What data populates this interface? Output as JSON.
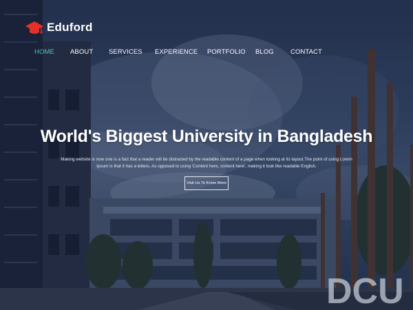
{
  "brand": {
    "name": "Eduford",
    "icon": "graduation-cap-icon",
    "icon_color": "#e8302a"
  },
  "nav": {
    "items": [
      {
        "label": "HOME",
        "active": true
      },
      {
        "label": "ABOUT",
        "active": false
      },
      {
        "label": "SERVICES",
        "active": false
      },
      {
        "label": "EXPERIENCE",
        "active": false
      },
      {
        "label": "PORTFOLIO",
        "active": false
      },
      {
        "label": "BLOG",
        "active": false
      },
      {
        "label": "CONTACT",
        "active": false
      }
    ],
    "active_color": "#4ec6b5"
  },
  "hero": {
    "title": "World's Biggest University in Bangladesh",
    "description": "Making website is now one is a fact that a reader will be distracted by the readable content of a page when looking at its layout.The point of using Lorem Ipsum is that it has a letters. As opposed to using 'Content here, content here', making it look like readable English.",
    "cta_label": "Visit Us To Know More",
    "building_sign": "DCU"
  }
}
